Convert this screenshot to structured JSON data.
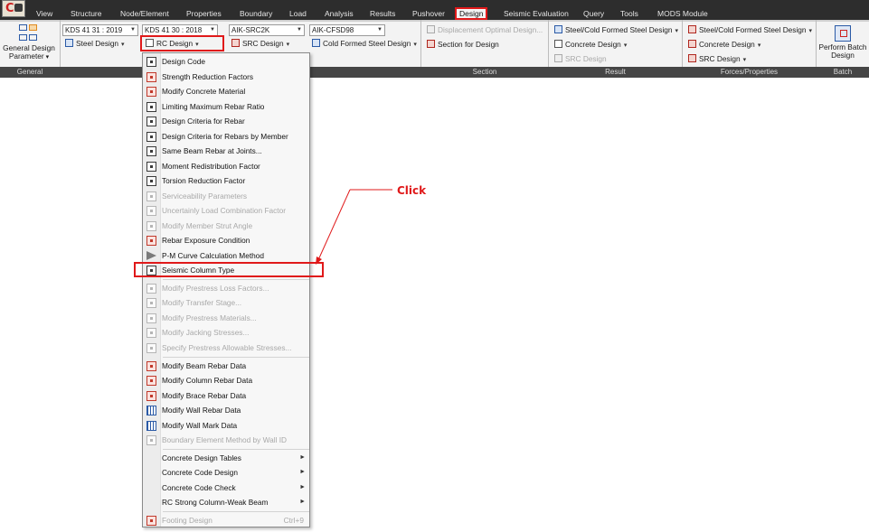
{
  "menubar": {
    "tabs": [
      "View",
      "Structure",
      "Node/Element",
      "Properties",
      "Boundary",
      "Load",
      "Analysis",
      "Results",
      "Pushover",
      "Design",
      "Seismic Evaluation",
      "Query",
      "Tools",
      "MODS Module"
    ],
    "active_tab": "Design"
  },
  "ribbon": {
    "general": {
      "button_label": "General Design Parameter",
      "group_label": "General"
    },
    "steel": {
      "code": "KDS 41 31 : 2019",
      "button_label": "Steel Design"
    },
    "rc": {
      "code": "KDS 41 30 : 2018",
      "button_label": "RC Design"
    },
    "src": {
      "code": "AIK-SRC2K",
      "button_label": "SRC Design"
    },
    "cfs": {
      "code": "AIK-CFSD98",
      "button_label": "Cold Formed Steel Design"
    },
    "section": {
      "item1": "Displacement Optimal Design...",
      "item2": "Section for Design",
      "group_label": "Section"
    },
    "result": {
      "item1": "Steel/Cold Formed Steel Design",
      "item2": "Concrete Design",
      "item3": "SRC Design",
      "group_label": "Result"
    },
    "forces": {
      "item1": "Steel/Cold Formed Steel Design",
      "item2": "Concrete Design",
      "item3": "SRC Design",
      "group_label": "Forces/Properties"
    },
    "batch": {
      "button_label": "Perform Batch Design",
      "group_label": "Batch"
    }
  },
  "dropdown": {
    "items": [
      {
        "label": "Design Code"
      },
      {
        "label": "Strength Reduction Factors"
      },
      {
        "label": "Modify Concrete Material"
      },
      {
        "label": "Limiting Maximum Rebar Ratio"
      },
      {
        "label": "Design Criteria for Rebar"
      },
      {
        "label": "Design Criteria for Rebars by Member"
      },
      {
        "label": "Same Beam Rebar at Joints..."
      },
      {
        "label": "Moment Redistribution Factor"
      },
      {
        "label": "Torsion Reduction Factor"
      },
      {
        "label": "Serviceability Parameters"
      },
      {
        "label": "Uncertainly Load Combination Factor"
      },
      {
        "label": "Modify Member Strut Angle"
      },
      {
        "label": "Rebar Exposure Condition"
      },
      {
        "label": "P-M Curve Calculation Method"
      },
      {
        "label": "Seismic Column Type"
      },
      {
        "label": "Modify Prestress Loss Factors..."
      },
      {
        "label": "Modify Transfer Stage..."
      },
      {
        "label": "Modify Prestress Materials..."
      },
      {
        "label": "Modify Jacking Stresses..."
      },
      {
        "label": "Specify Prestress Allowable Stresses..."
      },
      {
        "label": "Modify Beam Rebar Data"
      },
      {
        "label": "Modify Column Rebar Data"
      },
      {
        "label": "Modify Brace Rebar Data"
      },
      {
        "label": "Modify Wall Rebar Data"
      },
      {
        "label": "Modify Wall Mark Data"
      },
      {
        "label": "Boundary Element Method by Wall ID"
      },
      {
        "label": "Concrete Design Tables"
      },
      {
        "label": "Concrete Code Design"
      },
      {
        "label": "Concrete Code Check"
      },
      {
        "label": "RC Strong Column-Weak Beam"
      },
      {
        "label": "Footing Design",
        "shortcut": "Ctrl+9"
      }
    ]
  },
  "annotation": {
    "text": "Click"
  },
  "colors": {
    "highlight": "#e0191a",
    "menubar": "#2d2d2d",
    "ribbon": "#f3f3f3"
  }
}
